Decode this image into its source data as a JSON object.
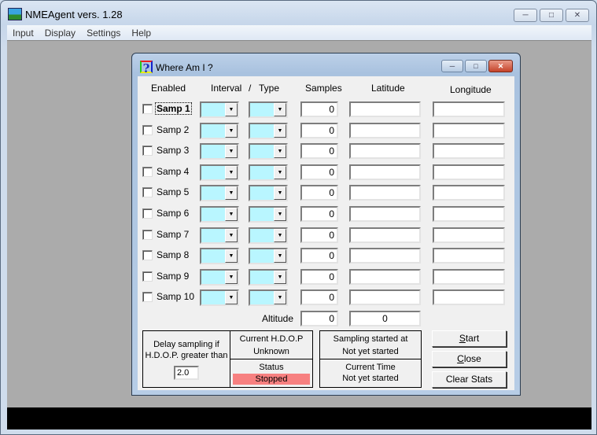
{
  "app": {
    "title": "NMEAgent vers. 1.28",
    "caption_buttons": [
      "minimize",
      "maximize",
      "close"
    ],
    "menu": [
      "Input",
      "Display",
      "Settings",
      "Help"
    ]
  },
  "dialog": {
    "title": "Where Am I ?",
    "headers": {
      "enabled": "Enabled",
      "interval": "Interval",
      "slash": "/",
      "type": "Type",
      "samples": "Samples",
      "latitude": "Latitude",
      "longitude": "Longitude"
    },
    "rows": [
      {
        "label": "Samp 1",
        "checked": false,
        "interval": "",
        "type": "",
        "samples": "0",
        "latitude": "",
        "longitude": ""
      },
      {
        "label": "Samp 2",
        "checked": false,
        "interval": "",
        "type": "",
        "samples": "0",
        "latitude": "",
        "longitude": ""
      },
      {
        "label": "Samp 3",
        "checked": false,
        "interval": "",
        "type": "",
        "samples": "0",
        "latitude": "",
        "longitude": ""
      },
      {
        "label": "Samp 4",
        "checked": false,
        "interval": "",
        "type": "",
        "samples": "0",
        "latitude": "",
        "longitude": ""
      },
      {
        "label": "Samp 5",
        "checked": false,
        "interval": "",
        "type": "",
        "samples": "0",
        "latitude": "",
        "longitude": ""
      },
      {
        "label": "Samp 6",
        "checked": false,
        "interval": "",
        "type": "",
        "samples": "0",
        "latitude": "",
        "longitude": ""
      },
      {
        "label": "Samp 7",
        "checked": false,
        "interval": "",
        "type": "",
        "samples": "0",
        "latitude": "",
        "longitude": ""
      },
      {
        "label": "Samp 8",
        "checked": false,
        "interval": "",
        "type": "",
        "samples": "0",
        "latitude": "",
        "longitude": ""
      },
      {
        "label": "Samp 9",
        "checked": false,
        "interval": "",
        "type": "",
        "samples": "0",
        "latitude": "",
        "longitude": ""
      },
      {
        "label": "Samp 10",
        "checked": false,
        "interval": "",
        "type": "",
        "samples": "0",
        "latitude": "",
        "longitude": ""
      }
    ],
    "altitude": {
      "label": "Altitude",
      "samples": "0",
      "value": "0"
    },
    "delay": {
      "line1": "Delay sampling if",
      "line2": "H.D.O.P. greater than",
      "value": "2.0"
    },
    "hdop": {
      "label": "Current H.D.O.P",
      "value": "Unknown"
    },
    "status": {
      "label": "Status",
      "value": "Stopped",
      "color": "#f78080"
    },
    "sampling_started": {
      "label": "Sampling started at",
      "value": "Not yet started"
    },
    "current_time": {
      "label": "Current Time",
      "value": "Not yet started"
    },
    "buttons": {
      "start_accel": "S",
      "start_rest": "tart",
      "close_accel": "C",
      "close_rest": "lose",
      "clear_stats": "Clear Stats"
    }
  }
}
